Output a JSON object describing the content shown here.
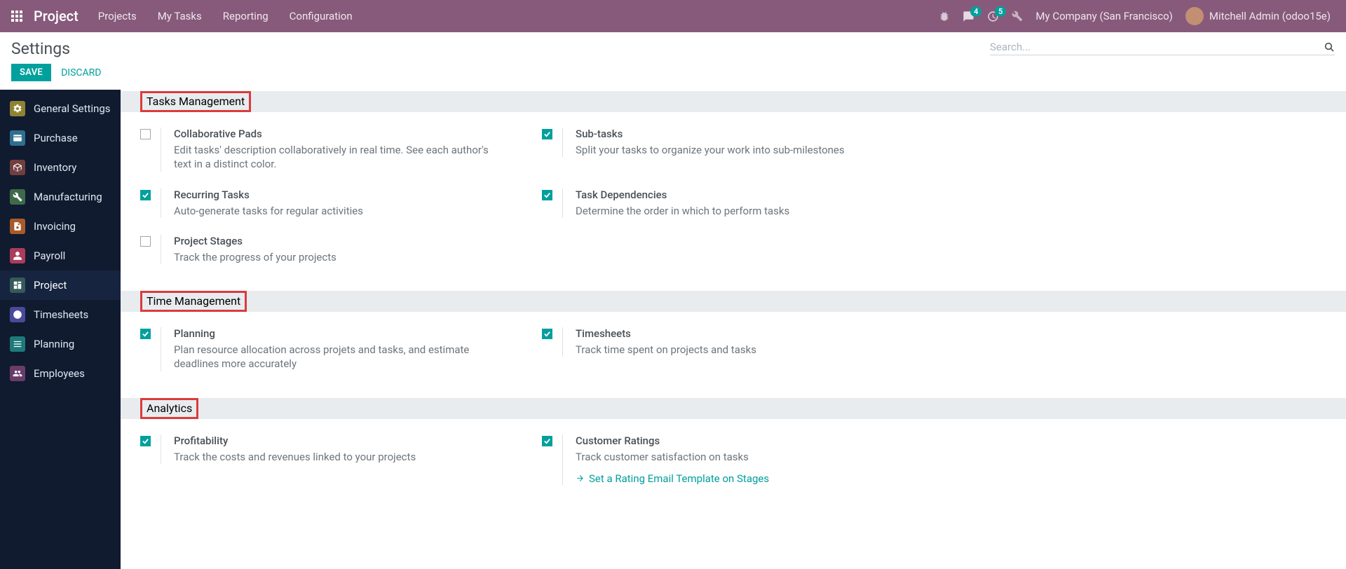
{
  "topnav": {
    "brand": "Project",
    "items": [
      "Projects",
      "My Tasks",
      "Reporting",
      "Configuration"
    ],
    "messages_badge": "4",
    "activities_badge": "5",
    "company": "My Company (San Francisco)",
    "user": "Mitchell Admin (odoo15e)"
  },
  "cp": {
    "title": "Settings",
    "save": "SAVE",
    "discard": "DISCARD",
    "search_placeholder": "Search..."
  },
  "sidebar": {
    "items": [
      {
        "label": "General Settings",
        "color": "#8f8333"
      },
      {
        "label": "Purchase",
        "color": "#2f6f8f"
      },
      {
        "label": "Inventory",
        "color": "#713f3f"
      },
      {
        "label": "Manufacturing",
        "color": "#3f6a4a"
      },
      {
        "label": "Invoicing",
        "color": "#a85a2a"
      },
      {
        "label": "Payroll",
        "color": "#aa3c5c"
      },
      {
        "label": "Project",
        "color": "#355a5a"
      },
      {
        "label": "Timesheets",
        "color": "#4a4a9a"
      },
      {
        "label": "Planning",
        "color": "#1e7a7a"
      },
      {
        "label": "Employees",
        "color": "#6a3c6a"
      }
    ],
    "active_index": 6
  },
  "sections": [
    {
      "title": "Tasks Management",
      "highlight": true,
      "rows": [
        [
          {
            "checked": false,
            "title": "Collaborative Pads",
            "desc": "Edit tasks' description collaboratively in real time. See each author's text in a distinct color."
          },
          {
            "checked": true,
            "title": "Sub-tasks",
            "desc": "Split your tasks to organize your work into sub-milestones"
          }
        ],
        [
          {
            "checked": true,
            "title": "Recurring Tasks",
            "desc": "Auto-generate tasks for regular activities"
          },
          {
            "checked": true,
            "title": "Task Dependencies",
            "desc": "Determine the order in which to perform tasks"
          }
        ],
        [
          {
            "checked": false,
            "title": "Project Stages",
            "desc": "Track the progress of your projects"
          }
        ]
      ]
    },
    {
      "title": "Time Management",
      "highlight": true,
      "rows": [
        [
          {
            "checked": true,
            "title": "Planning",
            "desc": "Plan resource allocation across projets and tasks, and estimate deadlines more accurately"
          },
          {
            "checked": true,
            "title": "Timesheets",
            "desc": "Track time spent on projects and tasks"
          }
        ]
      ]
    },
    {
      "title": "Analytics",
      "highlight": true,
      "rows": [
        [
          {
            "checked": true,
            "title": "Profitability",
            "desc": "Track the costs and revenues linked to your projects"
          },
          {
            "checked": true,
            "title": "Customer Ratings",
            "desc": "Track customer satisfaction on tasks",
            "link": "Set a Rating Email Template on Stages"
          }
        ]
      ]
    }
  ]
}
